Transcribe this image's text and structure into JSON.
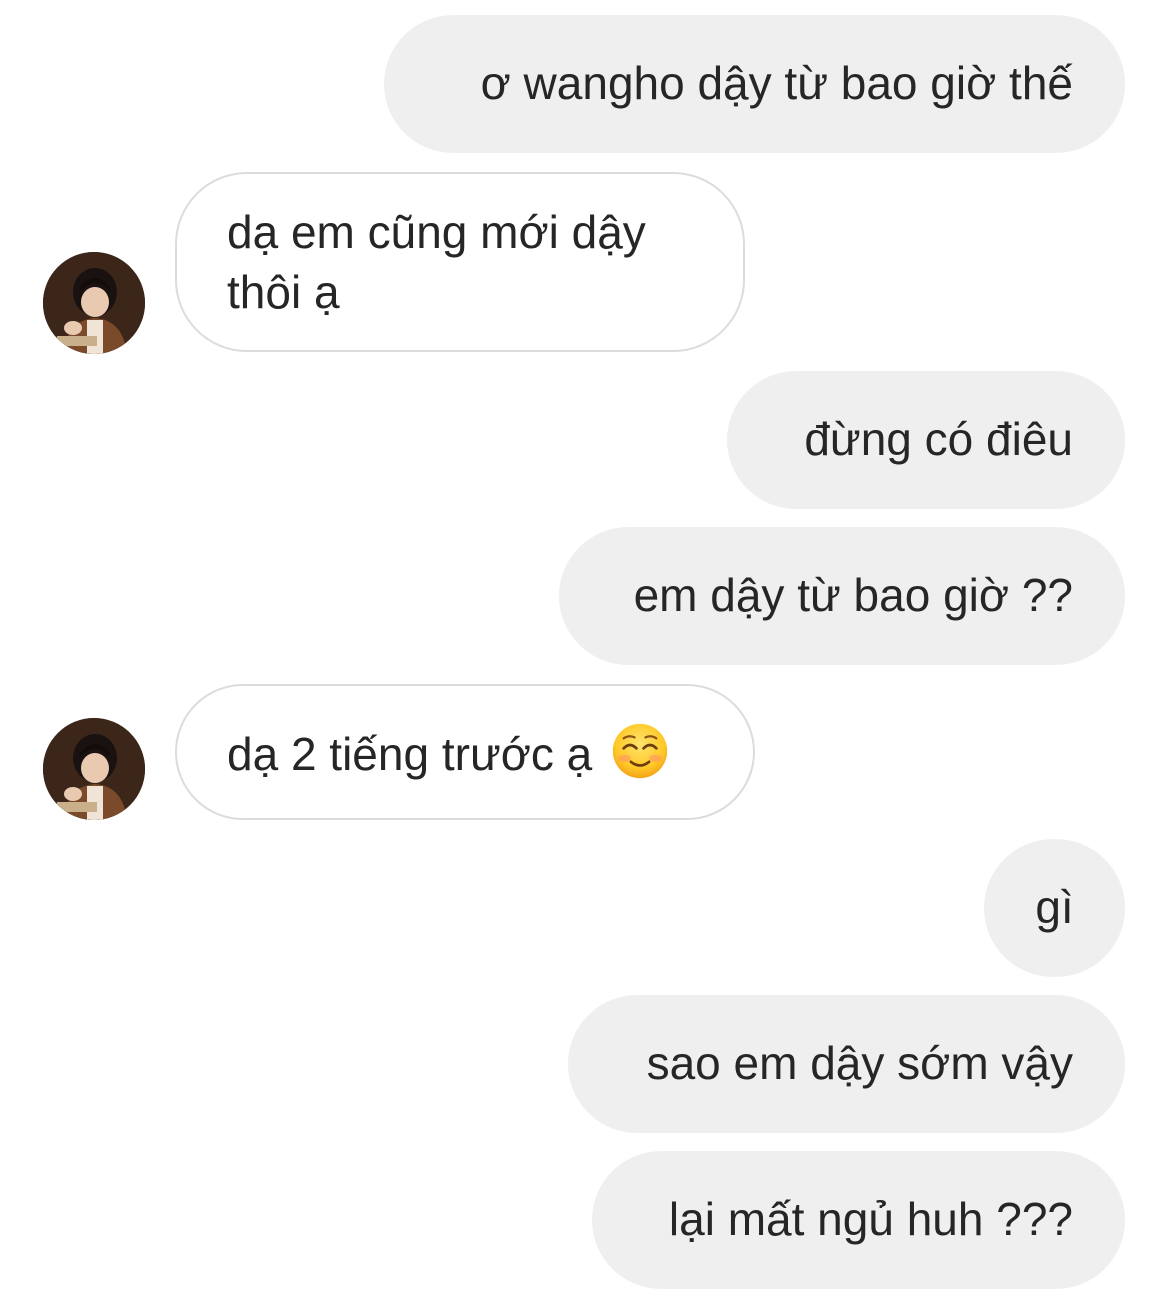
{
  "conversation": {
    "messages": [
      {
        "side": "sent",
        "text": "ơ wangho dậy từ bao giờ thế"
      },
      {
        "side": "received",
        "line1": "dạ em cũng mới dậy",
        "line2": "thôi ạ"
      },
      {
        "side": "sent",
        "text": "đừng có điêu"
      },
      {
        "side": "sent",
        "text": "em dậy từ bao giờ ??"
      },
      {
        "side": "received",
        "text": "dạ 2 tiếng trước ạ",
        "emoji": "smiling-face-emoji"
      },
      {
        "side": "sent",
        "text": "gì"
      },
      {
        "side": "sent",
        "text": "sao em dậy sớm vậy"
      },
      {
        "side": "sent",
        "text": "lại mất ngủ huh ???"
      }
    ]
  },
  "colors": {
    "sent_bubble": "#efefef",
    "received_border": "#dcdcdc",
    "text": "#262626"
  }
}
